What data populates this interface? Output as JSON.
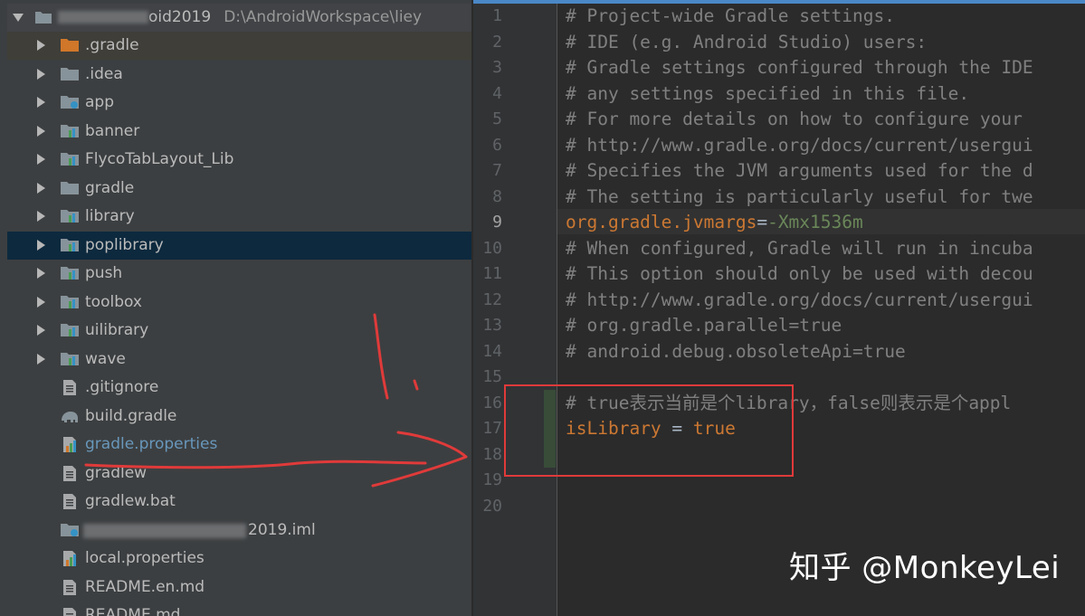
{
  "project": {
    "root_name": "oid2019",
    "root_path": "D:\\AndroidWorkspace\\liey",
    "items": [
      {
        "label": ".gradle",
        "type": "folder-orange",
        "expandable": true
      },
      {
        "label": ".idea",
        "type": "folder",
        "expandable": true
      },
      {
        "label": "app",
        "type": "module-folder",
        "expandable": true
      },
      {
        "label": "banner",
        "type": "module-folder",
        "expandable": true
      },
      {
        "label": "FlycoTabLayout_Lib",
        "type": "module-folder",
        "expandable": true
      },
      {
        "label": "gradle",
        "type": "folder",
        "expandable": true
      },
      {
        "label": "library",
        "type": "module-folder",
        "expandable": true
      },
      {
        "label": "poplibrary",
        "type": "module-folder",
        "expandable": true
      },
      {
        "label": "push",
        "type": "module-folder",
        "expandable": true
      },
      {
        "label": "toolbox",
        "type": "module-folder",
        "expandable": true
      },
      {
        "label": "uilibrary",
        "type": "module-folder",
        "expandable": true
      },
      {
        "label": "wave",
        "type": "module-folder",
        "expandable": true
      },
      {
        "label": ".gitignore",
        "type": "text-file",
        "expandable": false
      },
      {
        "label": "build.gradle",
        "type": "gradle-file",
        "expandable": false
      },
      {
        "label": "gradle.properties",
        "type": "properties-file",
        "expandable": false
      },
      {
        "label": "gradlew",
        "type": "text-file",
        "expandable": false
      },
      {
        "label": "gradlew.bat",
        "type": "text-file",
        "expandable": false
      },
      {
        "label": "2019.iml",
        "type": "iml-file",
        "expandable": false
      },
      {
        "label": "local.properties",
        "type": "properties-file",
        "expandable": false
      },
      {
        "label": "README.en.md",
        "type": "text-file",
        "expandable": false
      },
      {
        "label": "README.md",
        "type": "text-file",
        "expandable": false
      }
    ]
  },
  "editor": {
    "line_numbers": [
      "1",
      "2",
      "3",
      "4",
      "5",
      "6",
      "7",
      "8",
      "9",
      "10",
      "11",
      "12",
      "13",
      "14",
      "15",
      "16",
      "17",
      "18",
      "19",
      "20"
    ],
    "lines": {
      "l1": "# Project-wide Gradle settings.",
      "l2": "# IDE (e.g. Android Studio) users:",
      "l3": "# Gradle settings configured through the IDE",
      "l4": "# any settings specified in this file.",
      "l5": "# For more details on how to configure your",
      "l6": "# http://www.gradle.org/docs/current/usergui",
      "l7": "# Specifies the JVM arguments used for the d",
      "l8": "# The setting is particularly useful for twe",
      "l9_key": "org.gradle.jvmargs",
      "l9_eq": "=",
      "l9_val": "-Xmx1536m",
      "l10": "# When configured, Gradle will run in incuba",
      "l11": "# This option should only be used with decou",
      "l12": "# http://www.gradle.org/docs/current/usergui",
      "l13": "# org.gradle.parallel=true",
      "l14": "# android.debug.obsoleteApi=true",
      "l16": "# true表示当前是个library，false则表示是个appl",
      "l17_key": "isLibrary",
      "l17_eq": " = ",
      "l17_val": "true"
    }
  },
  "watermark": "知乎 @MonkeyLei",
  "colors": {
    "comment": "#808080",
    "key": "#cc7832",
    "value": "#6a8759",
    "annotation_red": "#e03a3a",
    "selection": "#0d293e"
  }
}
